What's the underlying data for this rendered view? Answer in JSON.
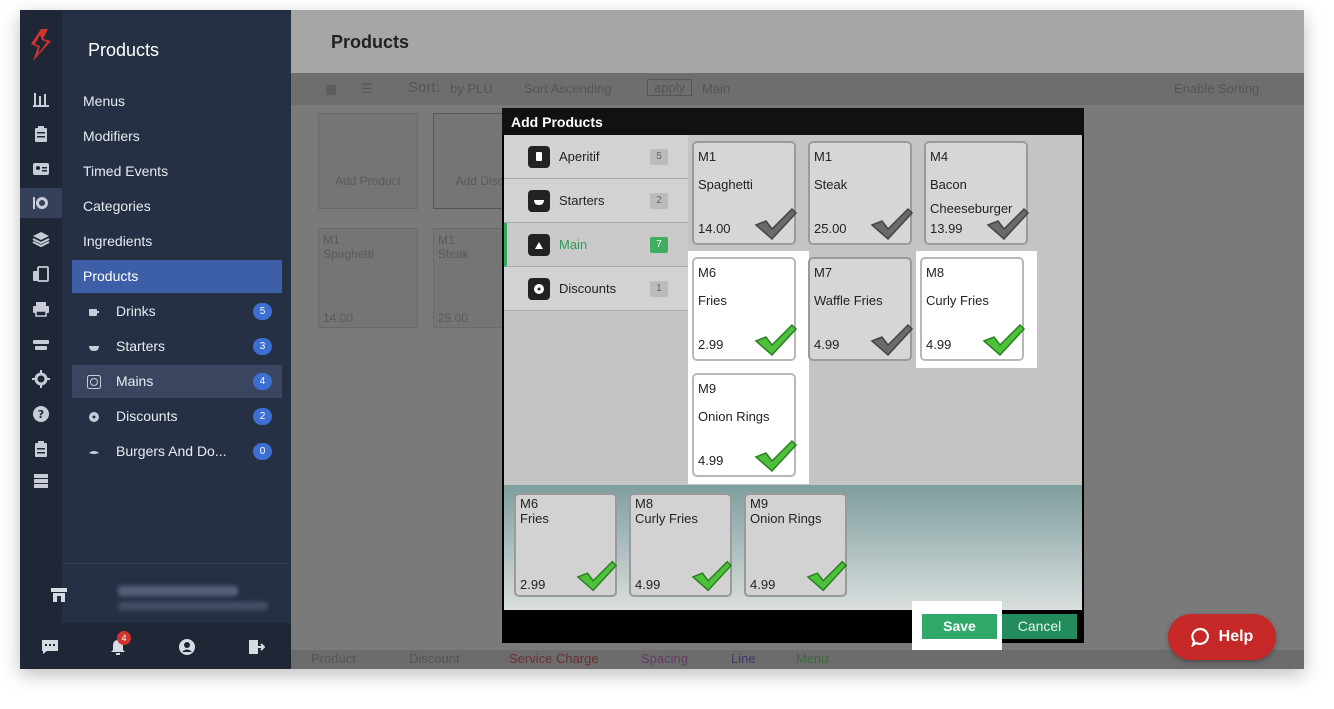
{
  "app": {
    "section_title": "Products",
    "page_title": "Products"
  },
  "nav": {
    "items": [
      {
        "label": "Menus"
      },
      {
        "label": "Modifiers"
      },
      {
        "label": "Timed Events"
      },
      {
        "label": "Categories"
      },
      {
        "label": "Ingredients"
      },
      {
        "label": "Products"
      }
    ],
    "sub_items": [
      {
        "label": "Drinks",
        "count": "5"
      },
      {
        "label": "Starters",
        "count": "3"
      },
      {
        "label": "Mains",
        "count": "4"
      },
      {
        "label": "Discounts",
        "count": "2"
      },
      {
        "label": "Burgers And Do...",
        "count": "0"
      }
    ],
    "notification_count": "4"
  },
  "toolbar": {
    "sort_label": "Sort:",
    "sort_by": "by PLU",
    "sort_order": "Sort Ascending",
    "apply": "apply",
    "menu": "Main",
    "enable_sorting": "Enable Sorting"
  },
  "background_tiles": [
    {
      "label": "Add Product"
    },
    {
      "label": "Add Disco"
    },
    {
      "plu": "M1",
      "name": "Spaghetti",
      "price": "14.00"
    },
    {
      "plu": "M1",
      "name": "Steak",
      "price": "25.00"
    }
  ],
  "legend": [
    "Product",
    "Discount",
    "Service Charge",
    "Spacing",
    "Line",
    "Menu"
  ],
  "modal": {
    "title": "Add Products",
    "categories": [
      {
        "label": "Aperitif",
        "count": "5"
      },
      {
        "label": "Starters",
        "count": "2"
      },
      {
        "label": "Main",
        "count": "7"
      },
      {
        "label": "Discounts",
        "count": "1"
      }
    ],
    "products": [
      {
        "plu": "M1",
        "name": "Spaghetti",
        "price": "14.00"
      },
      {
        "plu": "M1",
        "name": "Steak",
        "price": "25.00"
      },
      {
        "plu": "M4",
        "name": "Bacon Cheeseburger",
        "price": "13.99"
      },
      {
        "plu": "M6",
        "name": "Fries",
        "price": "2.99"
      },
      {
        "plu": "M7",
        "name": "Waffle Fries",
        "price": "4.99"
      },
      {
        "plu": "M8",
        "name": "Curly Fries",
        "price": "4.99"
      },
      {
        "plu": "M9",
        "name": "Onion Rings",
        "price": "4.99"
      }
    ],
    "selected": [
      {
        "plu": "M6",
        "name": "Fries",
        "price": "2.99"
      },
      {
        "plu": "M8",
        "name": "Curly Fries",
        "price": "4.99"
      },
      {
        "plu": "M9",
        "name": "Onion Rings",
        "price": "4.99"
      }
    ],
    "save": "Save",
    "cancel": "Cancel"
  },
  "help": {
    "label": "Help"
  },
  "colors": {
    "brand_red": "#d0342c",
    "active_blue": "#3c5fa8",
    "save_green": "#2fa86a",
    "help_red": "#c62828"
  }
}
